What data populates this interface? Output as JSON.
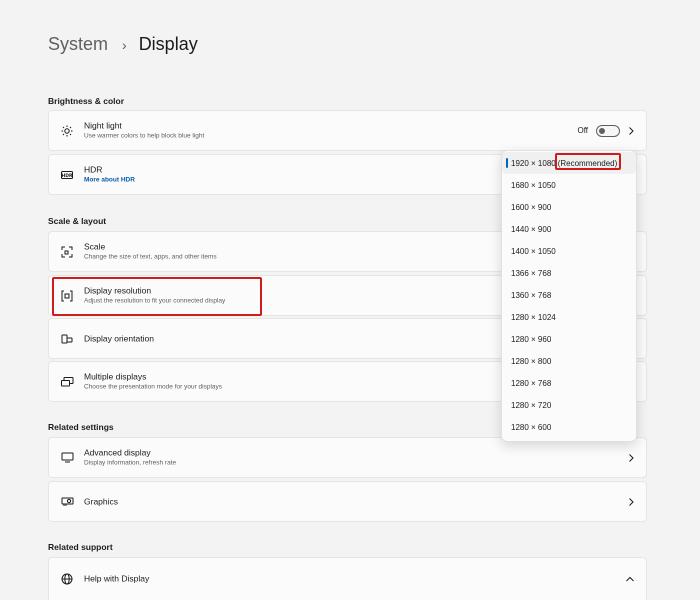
{
  "breadcrumb": {
    "parent": "System",
    "separator": "›",
    "current": "Display"
  },
  "sections": {
    "brightness": "Brightness & color",
    "scale_layout": "Scale & layout",
    "related_settings": "Related settings",
    "related_support": "Related support"
  },
  "night_light": {
    "title": "Night light",
    "desc": "Use warmer colors to help block blue light",
    "toggle_label": "Off"
  },
  "hdr": {
    "title": "HDR",
    "link": "More about HDR"
  },
  "scale": {
    "title": "Scale",
    "desc": "Change the size of text, apps, and other items"
  },
  "display_resolution": {
    "title": "Display resolution",
    "desc": "Adjust the resolution to fit your connected display"
  },
  "display_orientation": {
    "title": "Display orientation"
  },
  "multiple_displays": {
    "title": "Multiple displays",
    "desc": "Choose the presentation mode for your displays"
  },
  "advanced_display": {
    "title": "Advanced display",
    "desc": "Display information, refresh rate"
  },
  "graphics": {
    "title": "Graphics"
  },
  "help_display": {
    "title": "Help with Display"
  },
  "resolution_options": {
    "o0": "1920 × 1080",
    "o0_rec": "(Recommended)",
    "o1": "1680 × 1050",
    "o2": "1600 × 900",
    "o3": "1440 × 900",
    "o4": "1400 × 1050",
    "o5": "1366 × 768",
    "o6": "1360 × 768",
    "o7": "1280 × 1024",
    "o8": "1280 × 960",
    "o9": "1280 × 800",
    "o10": "1280 × 768",
    "o11": "1280 × 720",
    "o12": "1280 × 600"
  },
  "colors": {
    "accent": "#0067c0",
    "highlight": "#d11a1a"
  }
}
